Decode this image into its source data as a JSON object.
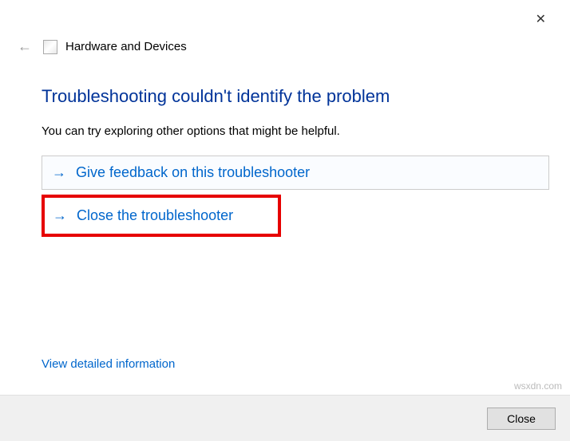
{
  "window": {
    "close_x": "✕",
    "back_arrow": "←",
    "title": "Hardware and Devices"
  },
  "main": {
    "heading": "Troubleshooting couldn't identify the problem",
    "subtext": "You can try exploring other options that might be helpful.",
    "options": [
      {
        "arrow": "→",
        "label": "Give feedback on this troubleshooter"
      },
      {
        "arrow": "→",
        "label": "Close the troubleshooter"
      }
    ],
    "detail_link": "View detailed information"
  },
  "footer": {
    "close_label": "Close"
  },
  "watermark": "wsxdn.com"
}
